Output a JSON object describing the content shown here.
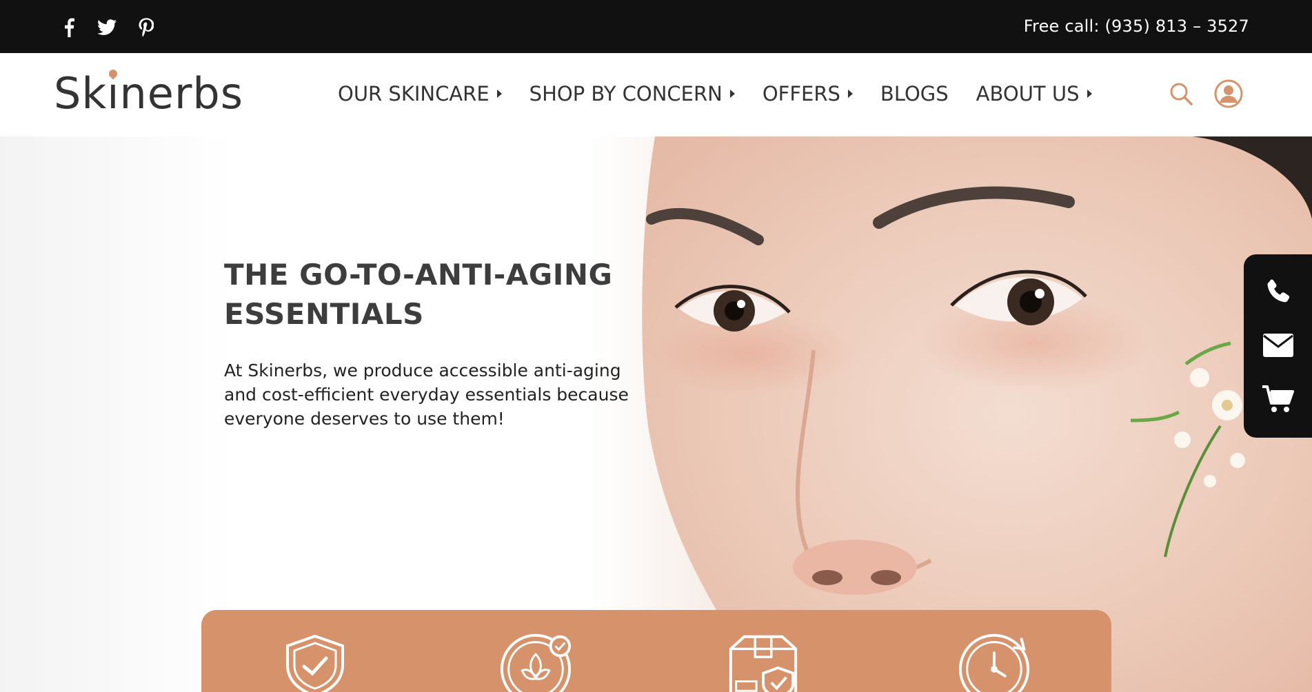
{
  "topbar": {
    "social_icons": [
      "facebook-icon",
      "twitter-icon",
      "pinterest-icon"
    ],
    "free_call": "Free call: (935) 813 – 3527"
  },
  "header": {
    "logo_text": "Skinerbs",
    "nav": [
      {
        "label": "OUR SKINCARE",
        "has_submenu": true
      },
      {
        "label": "SHOP BY CONCERN",
        "has_submenu": true
      },
      {
        "label": "OFFERS",
        "has_submenu": true
      },
      {
        "label": "BLOGS",
        "has_submenu": false
      },
      {
        "label": "ABOUT US",
        "has_submenu": true
      }
    ],
    "icons": [
      "search-icon",
      "user-icon"
    ]
  },
  "hero": {
    "title": "THE GO-TO-ANTI-AGING ESSENTIALS",
    "description": "At Skinerbs, we produce accessible anti-aging and cost-efficient everyday essentials because everyone deserves to use them!"
  },
  "side_widget": {
    "icons": [
      "phone-icon",
      "mail-icon",
      "cart-icon"
    ]
  },
  "features": {
    "icons": [
      "shield-check-icon",
      "leaf-check-icon",
      "box-shield-icon",
      "clock-refresh-icon"
    ]
  },
  "colors": {
    "accent": "#d6926a",
    "topbar_bg": "#111111",
    "text_dark": "#333333"
  }
}
